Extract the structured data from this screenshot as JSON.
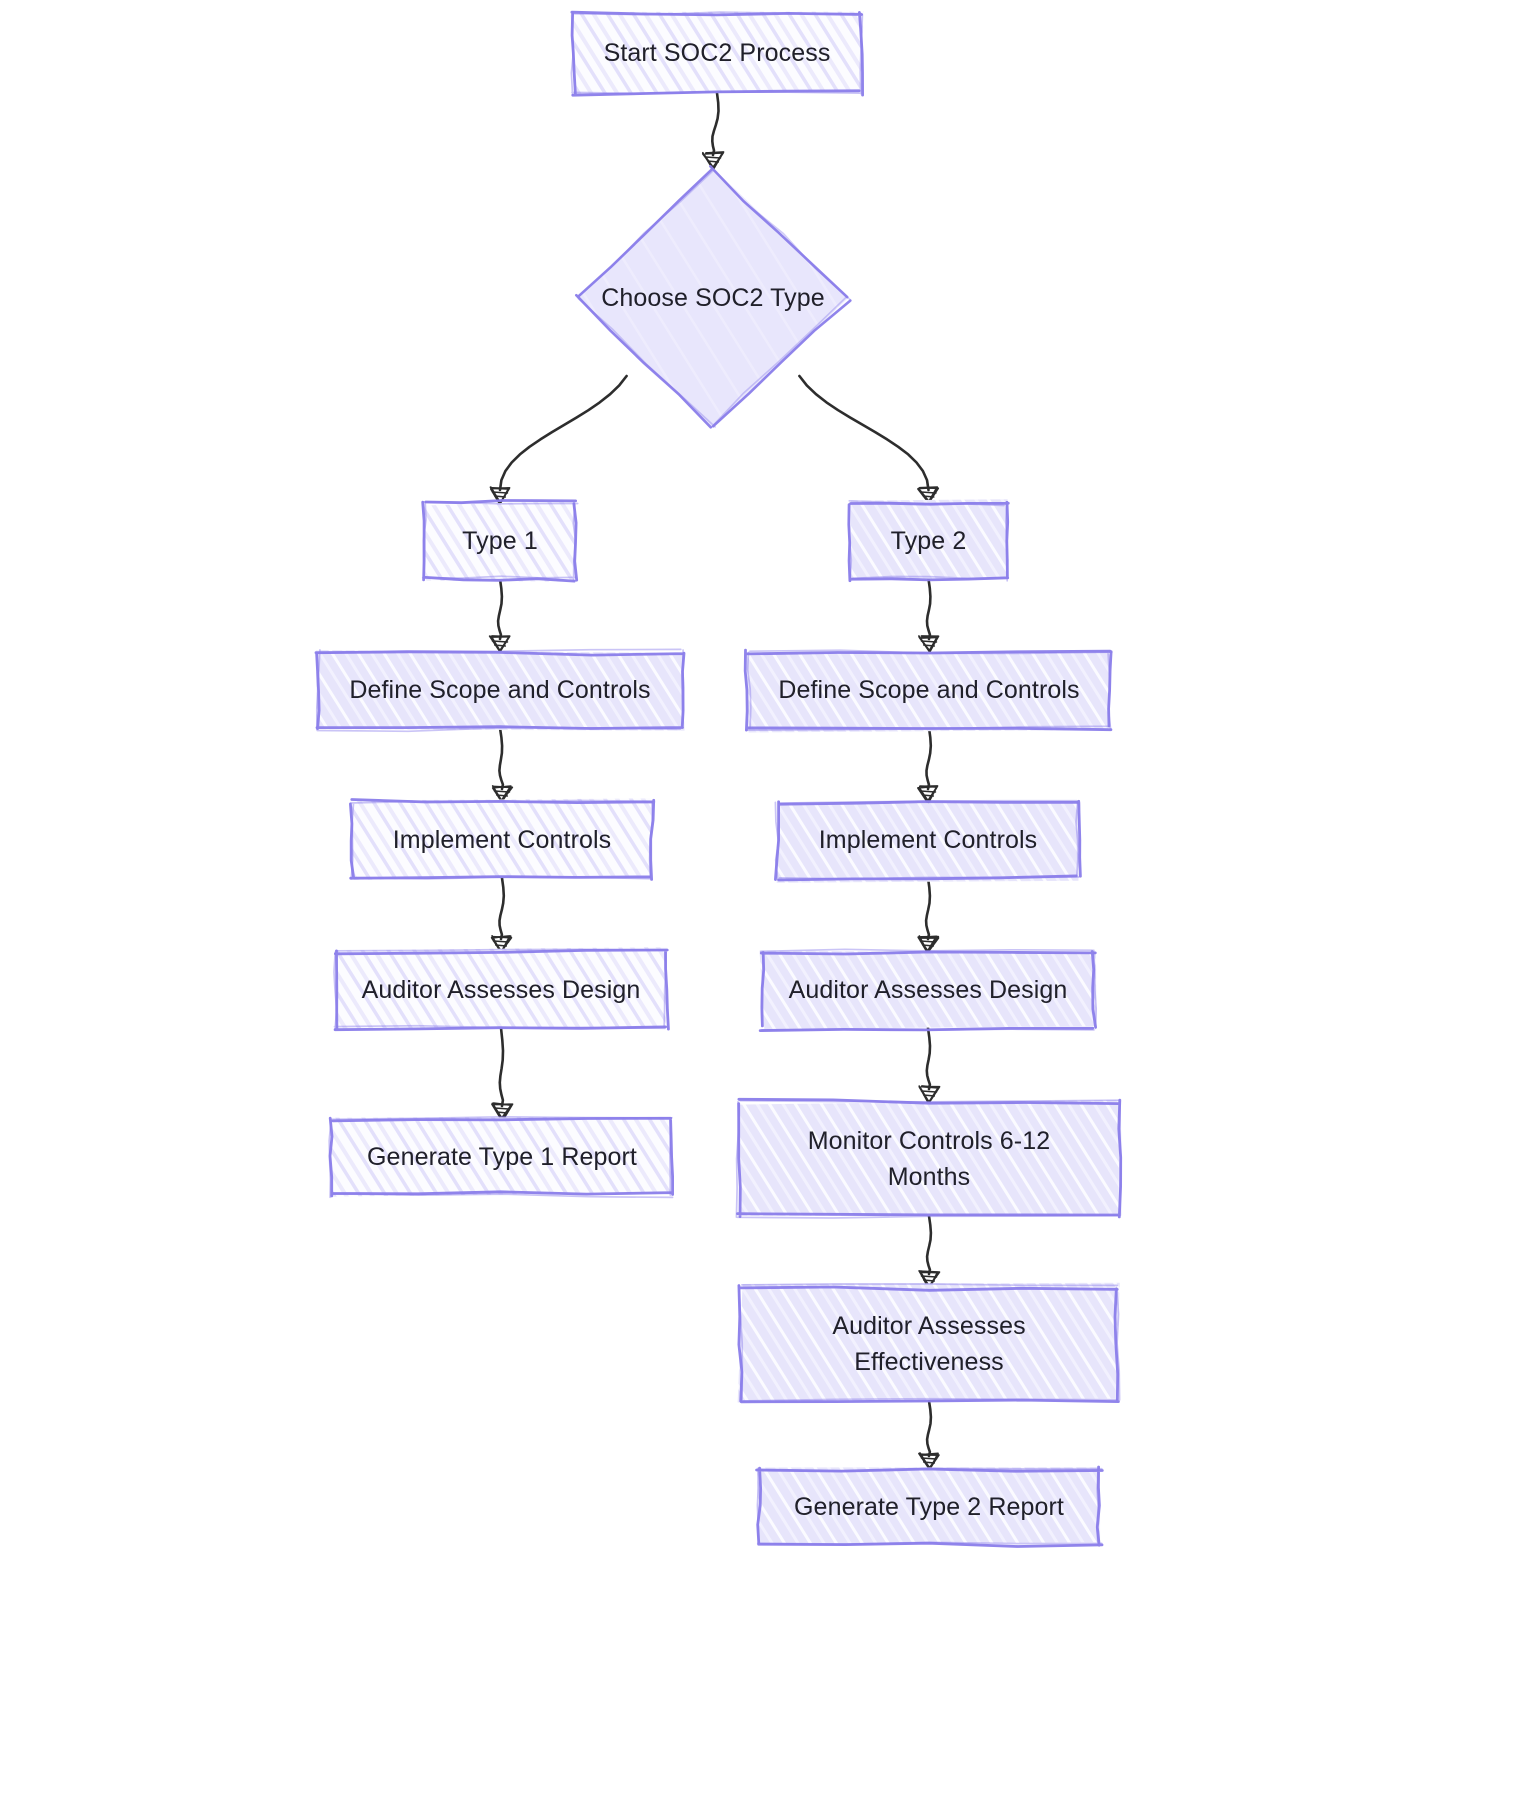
{
  "diagram": {
    "type": "flowchart",
    "orientation": "top-down",
    "style": "hand-drawn-sketch",
    "colors": {
      "stroke": "#8a7dea",
      "fill_light": "#fbfbff",
      "fill_strong": "#e7e6fb",
      "hatch_light": "#e2dffb",
      "hatch_strong": "#ffffff",
      "text": "#20202a",
      "edge": "#2b2b2b",
      "background": "#ffffff"
    }
  },
  "nodes": {
    "start": {
      "id": "start",
      "label": "Start SOC2 Process",
      "shape": "rect"
    },
    "decision": {
      "id": "decision",
      "label": "Choose SOC2 Type",
      "shape": "diamond"
    },
    "type1": {
      "id": "type1",
      "label": "Type 1",
      "shape": "rect"
    },
    "type2": {
      "id": "type2",
      "label": "Type 2",
      "shape": "rect"
    },
    "scope1": {
      "id": "scope1",
      "label": "Define Scope and Controls",
      "shape": "rect"
    },
    "scope2": {
      "id": "scope2",
      "label": "Define Scope and Controls",
      "shape": "rect"
    },
    "impl1": {
      "id": "impl1",
      "label": "Implement Controls",
      "shape": "rect"
    },
    "impl2": {
      "id": "impl2",
      "label": "Implement Controls",
      "shape": "rect"
    },
    "design1": {
      "id": "design1",
      "label": "Auditor Assesses Design",
      "shape": "rect"
    },
    "design2": {
      "id": "design2",
      "label": "Auditor Assesses Design",
      "shape": "rect"
    },
    "report1": {
      "id": "report1",
      "label": "Generate Type 1 Report",
      "shape": "rect"
    },
    "monitor2": {
      "id": "monitor2",
      "label": "Monitor Controls 6-12\nMonths",
      "shape": "rect"
    },
    "effective2": {
      "id": "effective2",
      "label": "Auditor Assesses\nEffectiveness",
      "shape": "rect"
    },
    "report2": {
      "id": "report2",
      "label": "Generate Type 2 Report",
      "shape": "rect"
    }
  },
  "edges": [
    {
      "from": "start",
      "to": "decision",
      "label": ""
    },
    {
      "from": "decision",
      "to": "type1",
      "label": ""
    },
    {
      "from": "decision",
      "to": "type2",
      "label": ""
    },
    {
      "from": "type1",
      "to": "scope1",
      "label": ""
    },
    {
      "from": "type2",
      "to": "scope2",
      "label": ""
    },
    {
      "from": "scope1",
      "to": "impl1",
      "label": ""
    },
    {
      "from": "scope2",
      "to": "impl2",
      "label": ""
    },
    {
      "from": "impl1",
      "to": "design1",
      "label": ""
    },
    {
      "from": "impl2",
      "to": "design2",
      "label": ""
    },
    {
      "from": "design1",
      "to": "report1",
      "label": ""
    },
    {
      "from": "design2",
      "to": "monitor2",
      "label": ""
    },
    {
      "from": "monitor2",
      "to": "effective2",
      "label": ""
    },
    {
      "from": "effective2",
      "to": "report2",
      "label": ""
    }
  ]
}
